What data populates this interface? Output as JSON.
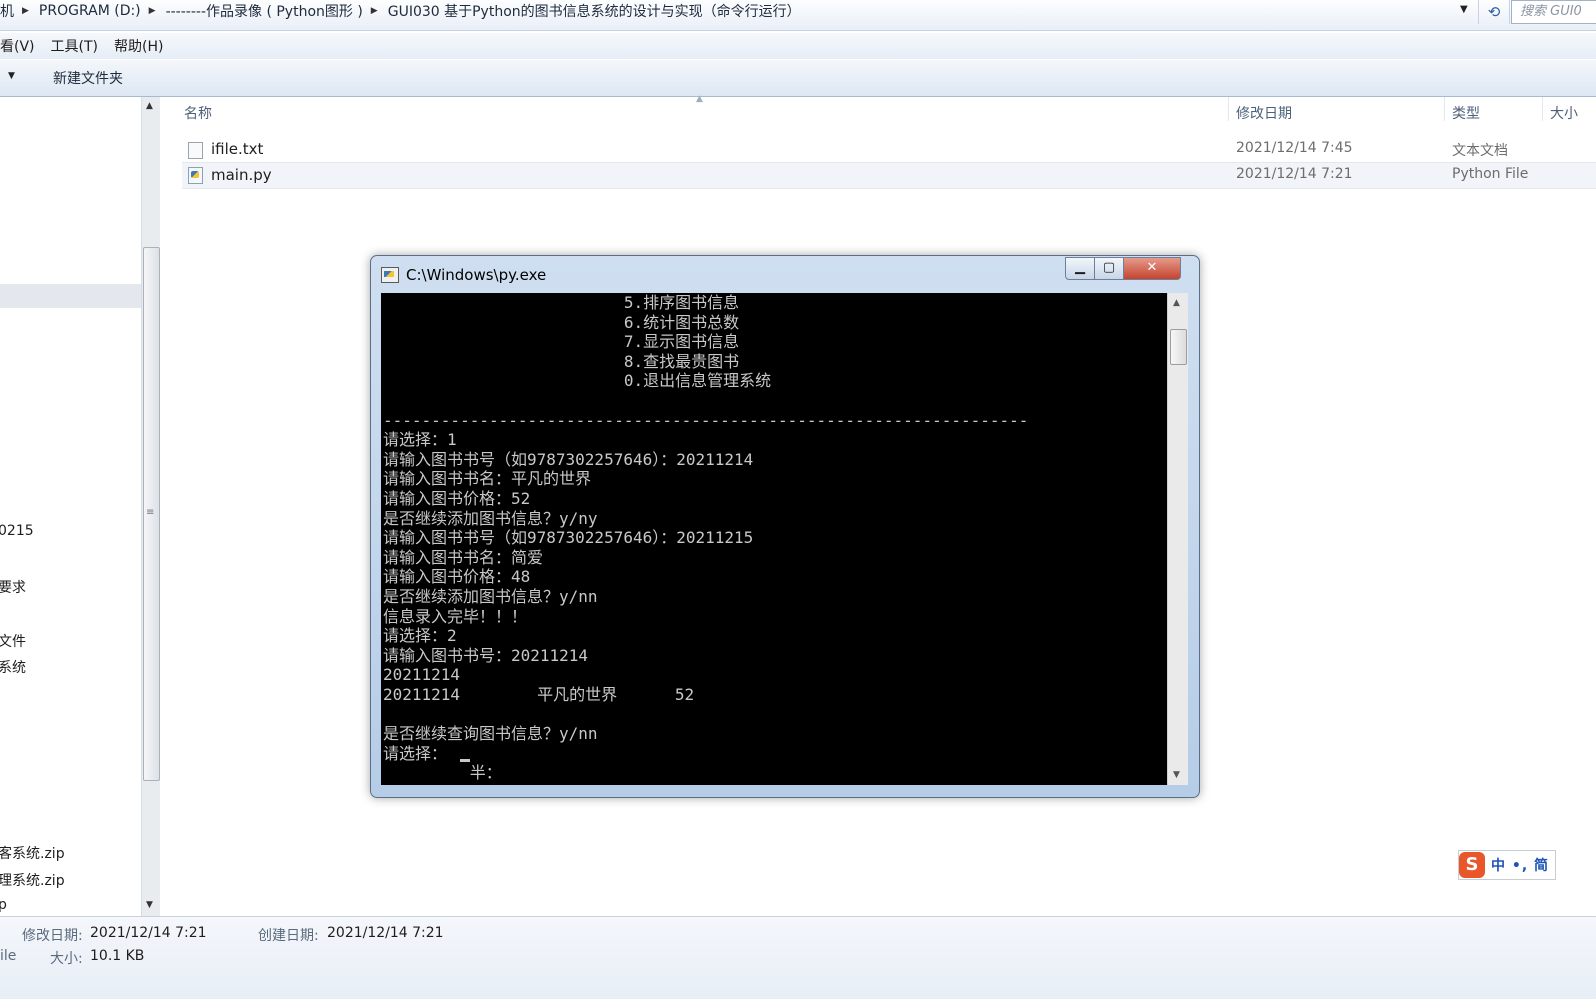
{
  "address_bar": {
    "crumbs": [
      "机",
      "PROGRAM (D:)",
      "--------作品录像 ( Python图形 )",
      "GUI030 基于Python的图书信息系统的设计与实现（命令行运行）"
    ],
    "search_placeholder": "搜索 GUI0"
  },
  "menu": {
    "items": [
      "看(V)",
      "工具(T)",
      "帮助(H)"
    ]
  },
  "toolbar": {
    "new_folder": "新建文件夹"
  },
  "nav": {
    "items": [
      "0215",
      "要求",
      "文件",
      "系统",
      "客系统.zip",
      "理系统.zip",
      "p"
    ]
  },
  "columns": {
    "name": "名称",
    "date": "修改日期",
    "type": "类型",
    "size": "大小"
  },
  "files": [
    {
      "name": "ifile.txt",
      "date": "2021/12/14 7:45",
      "type": "文本文档"
    },
    {
      "name": "main.py",
      "date": "2021/12/14 7:21",
      "type": "Python File"
    }
  ],
  "details": {
    "modified_label": "修改日期:",
    "modified_value": "2021/12/14 7:21",
    "created_label": "创建日期:",
    "created_value": "2021/12/14 7:21",
    "size_label": "大小:",
    "size_value": "10.1 KB",
    "type_fragment": "ile"
  },
  "console": {
    "title": "C:\\Windows\\py.exe",
    "text": "                         5.排序图书信息\n                         6.统计图书总数\n                         7.显示图书信息\n                         8.查找最贵图书\n                         0.退出信息管理系统\n\n-------------------------------------------------------------------\n请选择：1\n请输入图书书号（如9787302257646）：20211214\n请输入图书书名：平凡的世界\n请输入图书价格：52\n是否继续添加图书信息？y/ny\n请输入图书书号（如9787302257646）：20211215\n请输入图书书名：简爱\n请输入图书价格：48\n是否继续添加图书信息？y/nn\n信息录入完毕！！！\n请选择：2\n请输入图书书号：20211214\n20211214\n20211214        平凡的世界      52\n\n是否继续查询图书信息？y/nn\n请选择：\n         半："
  },
  "ime": {
    "logo": "S",
    "text": "中 •, 简"
  },
  "colors": {
    "accent": "#2c5fa5",
    "console_bg": "#000000",
    "console_fg": "#c8c8c8",
    "close_red": "#c5442f"
  },
  "icons": [
    "breadcrumb-arrow-icon",
    "refresh-icon",
    "txt-file-icon",
    "python-file-icon",
    "console-app-icon",
    "minimize-icon",
    "maximize-icon",
    "close-icon",
    "sogou-ime-icon"
  ]
}
